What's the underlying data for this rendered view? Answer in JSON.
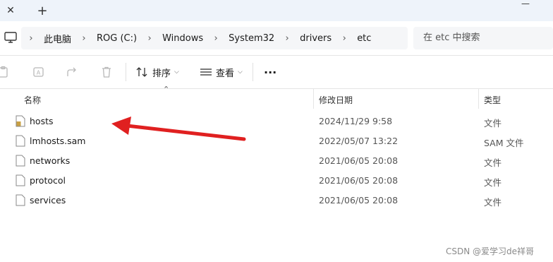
{
  "tabs": {
    "close_symbol": "✕",
    "new_symbol": "+",
    "minimize_symbol": "—"
  },
  "breadcrumb": [
    "此电脑",
    "ROG (C:)",
    "Windows",
    "System32",
    "drivers",
    "etc"
  ],
  "search": {
    "placeholder": "在 etc 中搜索"
  },
  "toolbar": {
    "sort_label": "排序",
    "view_label": "查看",
    "more_label": "···"
  },
  "columns": {
    "name": "名称",
    "modified": "修改日期",
    "type": "类型"
  },
  "files": [
    {
      "name": "hosts",
      "modified": "2024/11/29 9:58",
      "type": "文件"
    },
    {
      "name": "lmhosts.sam",
      "modified": "2022/05/07 13:22",
      "type": "SAM 文件"
    },
    {
      "name": "networks",
      "modified": "2021/06/05 20:08",
      "type": "文件"
    },
    {
      "name": "protocol",
      "modified": "2021/06/05 20:08",
      "type": "文件"
    },
    {
      "name": "services",
      "modified": "2021/06/05 20:08",
      "type": "文件"
    }
  ],
  "annotation": {
    "arrow_color": "#e02020"
  },
  "watermark": "CSDN @爱学习de祥哥",
  "icons": {
    "pc": "pc-icon",
    "file": "file-icon",
    "hosts": "hosts-file-icon",
    "copy": "copy-icon",
    "rename": "rename-icon",
    "share": "share-icon",
    "delete": "delete-icon",
    "sort": "sort-icon",
    "view": "view-icon"
  }
}
